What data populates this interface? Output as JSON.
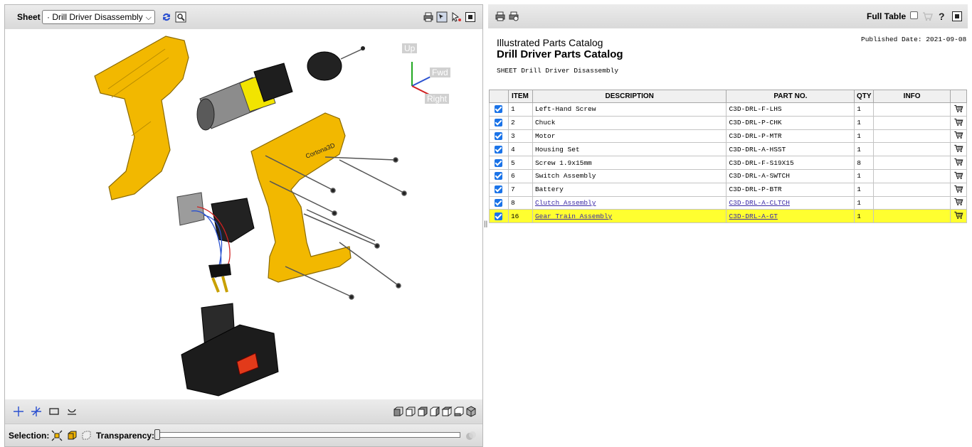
{
  "viewer": {
    "sheet_label": "Sheet",
    "sheet_selected": "· Drill Driver Disassembly",
    "axes": {
      "up": "Up",
      "fwd": "Fwd",
      "right": "Right"
    },
    "brand_text": "Cortona3D",
    "selection_label": "Selection:",
    "transparency_label": "Transparency:",
    "transparency_value": 0
  },
  "catalog": {
    "full_table_label": "Full Table",
    "heading": "Illustrated Parts Catalog",
    "title": "Drill Driver Parts Catalog",
    "sheet_line": "SHEET Drill Driver Disassembly",
    "published": "Published Date: 2021-09-08",
    "columns": [
      "ITEM",
      "DESCRIPTION",
      "PART NO.",
      "QTY",
      "INFO"
    ],
    "rows": [
      {
        "item": "1",
        "description": "Left-Hand Screw",
        "part_no": "C3D-DRL-F-LHS",
        "qty": "1",
        "info": ""
      },
      {
        "item": "2",
        "description": "Chuck",
        "part_no": "C3D-DRL-P-CHK",
        "qty": "1",
        "info": ""
      },
      {
        "item": "3",
        "description": "Motor",
        "part_no": "C3D-DRL-P-MTR",
        "qty": "1",
        "info": ""
      },
      {
        "item": "4",
        "description": "Housing Set",
        "part_no": "C3D-DRL-A-HSST",
        "qty": "1",
        "info": ""
      },
      {
        "item": "5",
        "description": "Screw 1.9x15mm",
        "part_no": "C3D-DRL-F-S19X15",
        "qty": "8",
        "info": ""
      },
      {
        "item": "6",
        "description": "Switch Assembly",
        "part_no": "C3D-DRL-A-SWTCH",
        "qty": "1",
        "info": ""
      },
      {
        "item": "7",
        "description": "Battery",
        "part_no": "C3D-DRL-P-BTR",
        "qty": "1",
        "info": ""
      },
      {
        "item": "8",
        "description": "Clutch Assembly",
        "part_no": "C3D-DRL-A-CLTCH",
        "qty": "1",
        "info": ""
      },
      {
        "item": "16",
        "description": "Gear Train Assembly",
        "part_no": "C3D-DRL-A-GT",
        "qty": "1",
        "info": ""
      }
    ],
    "link_rows": [
      7,
      8
    ],
    "highlight_row": 8
  },
  "colors": {
    "highlight": "#ffff30",
    "housing": "#f2b800",
    "checkbox": "#1a73e8",
    "link": "#3b2aa8"
  }
}
